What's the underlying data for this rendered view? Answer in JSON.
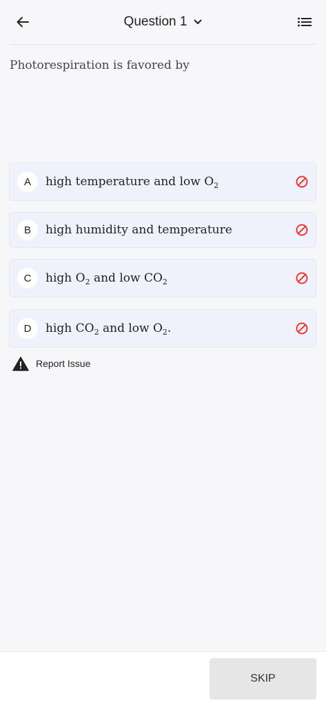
{
  "header": {
    "title": "Question 1",
    "back_icon": "arrow-left-icon",
    "dropdown_icon": "chevron-down-icon",
    "list_icon": "list-icon"
  },
  "question": {
    "text": "Photorespiration is favored by"
  },
  "options": [
    {
      "letter": "A",
      "parts": [
        "high temperature and low O",
        "2",
        ""
      ]
    },
    {
      "letter": "B",
      "parts": [
        "high humidity and temperature"
      ]
    },
    {
      "letter": "C",
      "parts": [
        "high O",
        "2",
        " and low CO",
        "2",
        ""
      ]
    },
    {
      "letter": "D",
      "parts": [
        "high CO",
        "2",
        " and low O",
        "2",
        "."
      ]
    }
  ],
  "option_eliminate_icon": "eliminate-icon",
  "colors": {
    "eliminate": "#e53935",
    "option_bg": "#eff1fb",
    "background": "#f7f7f9"
  },
  "report": {
    "label": "Report Issue",
    "icon": "warning-icon"
  },
  "footer": {
    "skip_label": "SKIP"
  }
}
